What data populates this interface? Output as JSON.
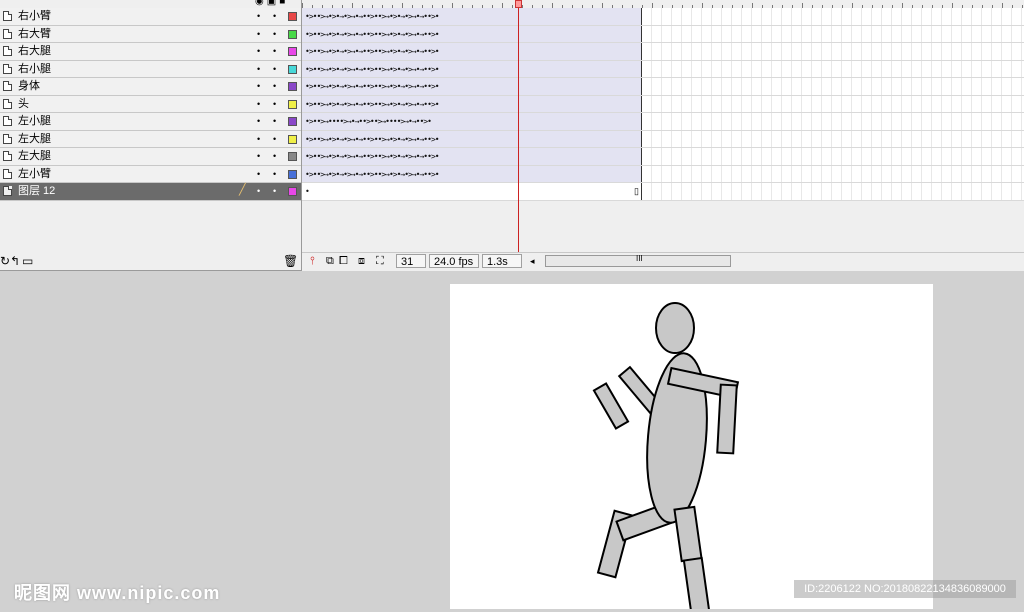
{
  "layers": [
    {
      "name": "右小臂",
      "color": "#e84848",
      "selected": false
    },
    {
      "name": "右大臂",
      "color": "#48d848",
      "selected": false
    },
    {
      "name": "右大腿",
      "color": "#e848e8",
      "selected": false
    },
    {
      "name": "右小腿",
      "color": "#48d8d8",
      "selected": false
    },
    {
      "name": "身体",
      "color": "#8a48c8",
      "selected": false
    },
    {
      "name": "头",
      "color": "#f0f048",
      "selected": false
    },
    {
      "name": "左小腿",
      "color": "#8a48c8",
      "selected": false
    },
    {
      "name": "左大腿",
      "color": "#f0f048",
      "selected": false
    },
    {
      "name": "左大腿",
      "color": "#888888",
      "selected": false
    },
    {
      "name": "左小臂",
      "color": "#4870d8",
      "selected": false
    },
    {
      "name": "图层 12",
      "color": "#e848e8",
      "selected": true
    }
  ],
  "frames": {
    "pattern_a": "•>••>→•>•→•>→•→••>••>→•>•→•>→•→••>•",
    "pattern_b": "•>••>→•>•→•>→•→••>••>→•>•→•>→•→••>•",
    "pattern_c": "•>••>→••••>→•→••>••>→••••>→•→••>•",
    "layer12_first": "•",
    "layer12_last": "▯"
  },
  "timeline_status": {
    "current_frame": "31",
    "frame_rate": "24.0 fps",
    "elapsed_time": "1.3s",
    "scroll_left": "◂",
    "scroll_grip": "III"
  },
  "watermark": {
    "left_text": "昵图网 www.nipic.com",
    "right_text": "ID:2206122 NO:20180822134836089000"
  },
  "colors": {
    "playhead": "#cc2222",
    "figure_fill": "#c8c8c8",
    "selected_layer": "#6b6b6b"
  }
}
